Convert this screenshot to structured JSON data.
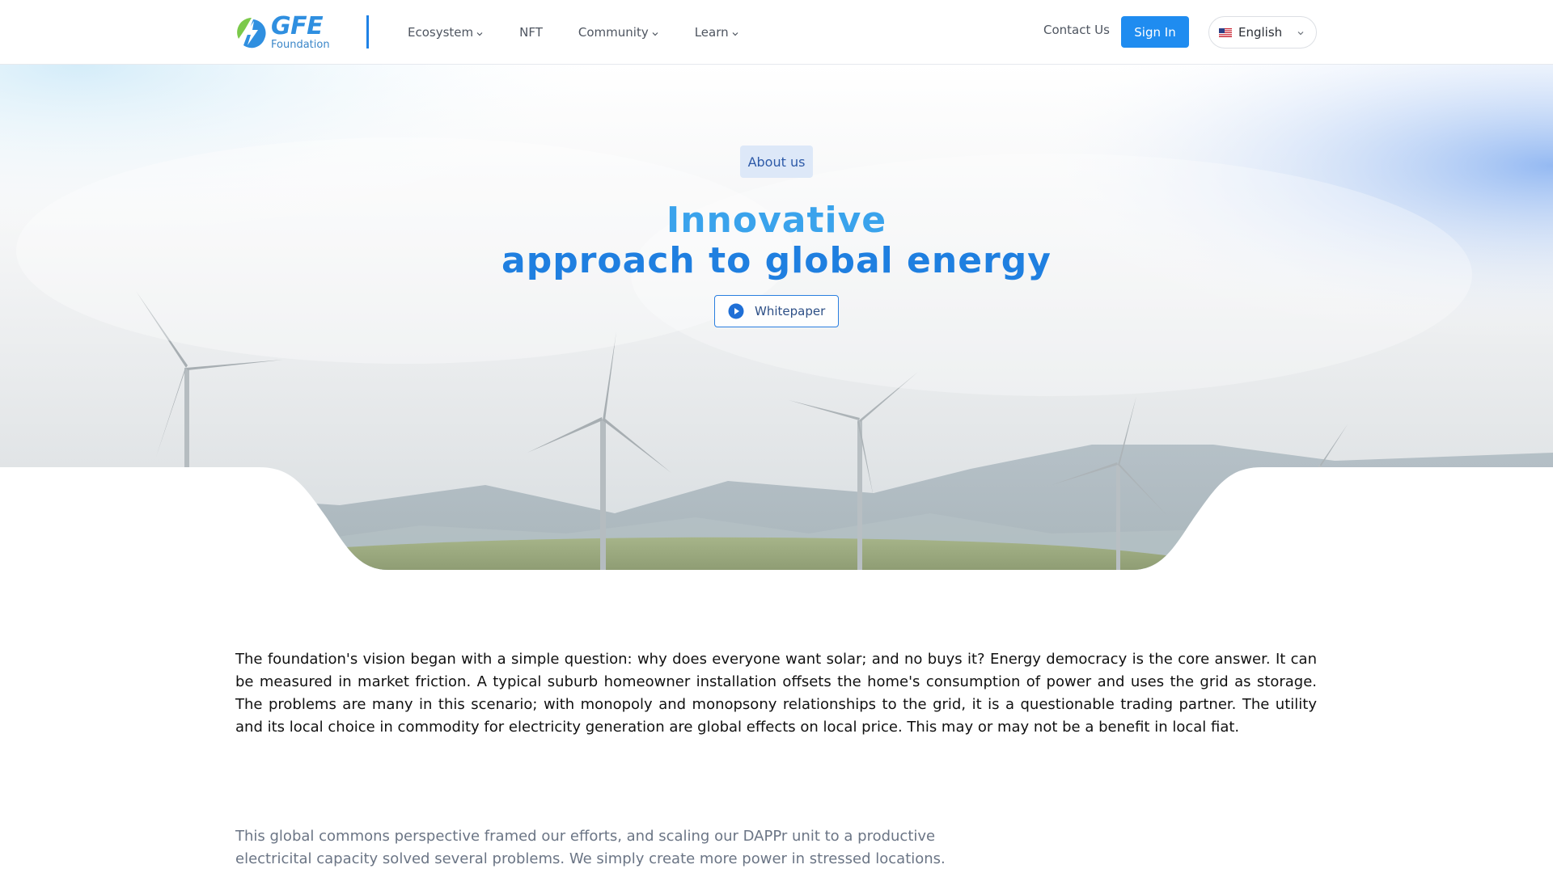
{
  "header": {
    "logo_title": "GFE",
    "logo_sub": "Foundation",
    "nav": [
      {
        "label": "Ecosystem",
        "has_dropdown": true,
        "icon": "chevron-down-icon"
      },
      {
        "label": "NFT",
        "has_dropdown": false
      },
      {
        "label": "Community",
        "has_dropdown": true,
        "icon": "chevron-down-icon"
      },
      {
        "label": "Learn",
        "has_dropdown": true,
        "icon": "chevron-down-icon"
      }
    ],
    "contact_label": "Contact Us",
    "signin_label": "Sign In",
    "language": {
      "label": "English",
      "flag_icon": "us-flag-icon"
    }
  },
  "hero": {
    "badge": "About us",
    "title_line1": "Innovative",
    "title_line2": "approach to global energy",
    "whitepaper_label": "Whitepaper",
    "whitepaper_icon": "play-icon"
  },
  "content": {
    "paragraph": "The foundation's vision began with a simple question: why does everyone want solar; and no buys it? Energy democracy is the core answer. It can be measured in market friction. A typical suburb homeowner installation offsets the home's consumption of power and uses the grid as storage. The problems are many in this scenario; with monopoly and monopsony relationships to the grid, it is a questionable trading partner. The utility and its local choice in commodity for electricity generation are global effects on local price. This may or may not be a benefit in local fiat.",
    "paragraph2": "This global commons perspective framed our efforts, and scaling our DAPPr unit to a productive electricital capacity solved several problems. We simply create more power in stressed locations."
  },
  "colors": {
    "brand_blue": "#1f8cf0",
    "title_blue": "#2a8ee6",
    "badge_bg": "#dde8f8",
    "text_dark": "#111111",
    "text_muted": "#6b7585"
  }
}
